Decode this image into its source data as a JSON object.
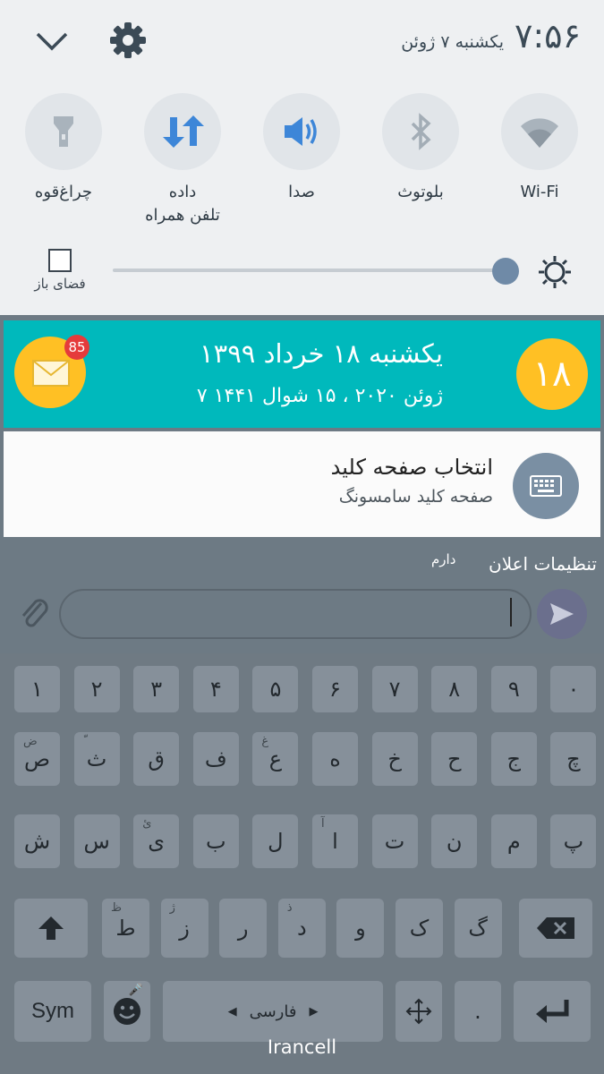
{
  "status": {
    "time": "۷:۵۶",
    "date": "یکشنبه ۷ ژوئن"
  },
  "quick_settings": [
    {
      "label": "Wi-Fi",
      "icon": "wifi-icon"
    },
    {
      "label": "بلوتوث",
      "icon": "bluetooth-icon"
    },
    {
      "label": "صدا",
      "icon": "volume-icon"
    },
    {
      "label": "داده",
      "sub": "تلفن همراه",
      "icon": "mobile-data-icon"
    },
    {
      "label": "چراغ‌قوه",
      "icon": "flashlight-icon"
    }
  ],
  "open_space_label": "فضای باز",
  "brightness": 0.94,
  "calendar_notification": {
    "day_badge": "۱۸",
    "line1": "یکشنبه  ۱۸  خرداد  ۱۳۹۹",
    "line2": "۷  ژوئن  ۲۰۲۰ ،  ۱۵  شوال  ۱۴۴۱",
    "mail_count": "85"
  },
  "keyboard_notification": {
    "title": "انتخاب صفحه کلید",
    "subtitle": "صفحه کلید سامسونگ"
  },
  "notification_settings": "تنظیمات اعلان",
  "behind_text": "دارم",
  "keyboard": {
    "row1": [
      "۱",
      "۲",
      "۳",
      "۴",
      "۵",
      "۶",
      "۷",
      "۸",
      "۹",
      "۰"
    ],
    "row2": [
      {
        "k": "ص",
        "h": "ض"
      },
      {
        "k": "ث",
        "h": "ّ"
      },
      {
        "k": "ق",
        "h": ""
      },
      {
        "k": "ف",
        "h": ""
      },
      {
        "k": "ع",
        "h": "غ"
      },
      {
        "k": "ه",
        "h": ""
      },
      {
        "k": "خ",
        "h": ""
      },
      {
        "k": "ح",
        "h": ""
      },
      {
        "k": "ج",
        "h": ""
      },
      {
        "k": "چ",
        "h": ""
      }
    ],
    "row3": [
      {
        "k": "ش",
        "h": ""
      },
      {
        "k": "س",
        "h": ""
      },
      {
        "k": "ی",
        "h": "ئ"
      },
      {
        "k": "ب",
        "h": ""
      },
      {
        "k": "ل",
        "h": ""
      },
      {
        "k": "ا",
        "h": "آ"
      },
      {
        "k": "ت",
        "h": ""
      },
      {
        "k": "ن",
        "h": ""
      },
      {
        "k": "م",
        "h": ""
      },
      {
        "k": "پ",
        "h": ""
      }
    ],
    "row4": [
      {
        "k": "ط",
        "h": "ظ"
      },
      {
        "k": "ز",
        "h": "ژ"
      },
      {
        "k": "ر",
        "h": ""
      },
      {
        "k": "د",
        "h": "ذ"
      },
      {
        "k": "و",
        "h": ""
      },
      {
        "k": "ک",
        "h": ""
      },
      {
        "k": "گ",
        "h": ""
      }
    ],
    "sym": "Sym",
    "space": "فارسی",
    "period": "."
  },
  "carrier": "Irancell"
}
